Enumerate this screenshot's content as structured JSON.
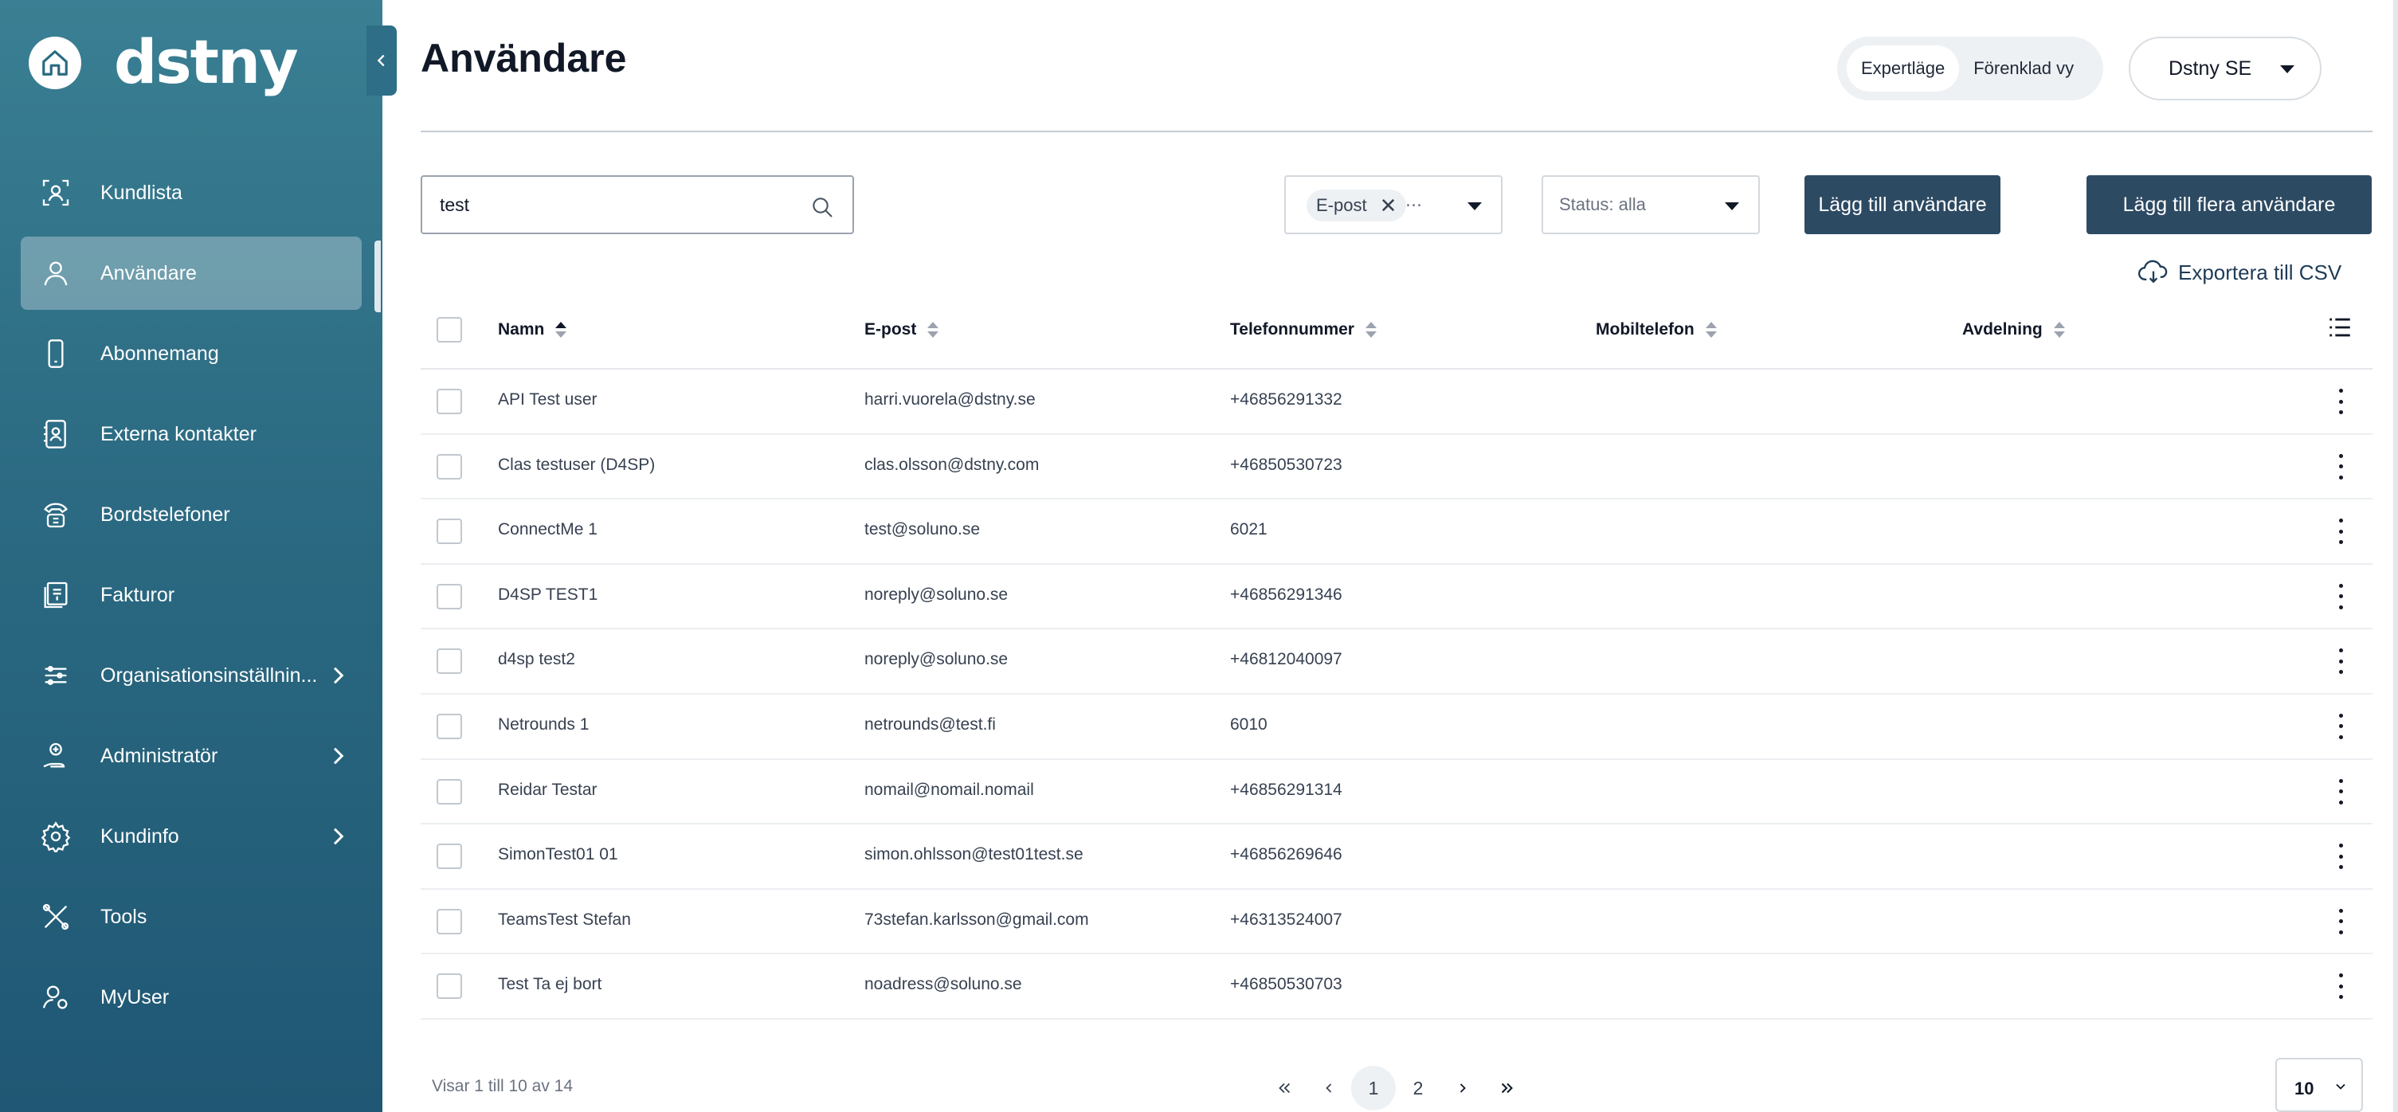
{
  "brand": {
    "logo_text": "dstny"
  },
  "sidebar": {
    "items": [
      {
        "label": "Kundlista",
        "icon": "customer-list-icon"
      },
      {
        "label": "Användare",
        "icon": "user-icon",
        "active": true
      },
      {
        "label": "Abonnemang",
        "icon": "mobile-phone-icon"
      },
      {
        "label": "Externa kontakter",
        "icon": "contact-book-icon"
      },
      {
        "label": "Bordstelefoner",
        "icon": "desk-phone-icon"
      },
      {
        "label": "Fakturor",
        "icon": "invoice-icon"
      },
      {
        "label": "Organisationsinställnin...",
        "icon": "sliders-icon",
        "expandable": true
      },
      {
        "label": "Administratör",
        "icon": "admin-icon",
        "expandable": true
      },
      {
        "label": "Kundinfo",
        "icon": "gear-icon",
        "expandable": true
      },
      {
        "label": "Tools",
        "icon": "tools-icon"
      },
      {
        "label": "MyUser",
        "icon": "user-gear-icon"
      }
    ]
  },
  "header": {
    "title": "Användare",
    "modes": [
      "Expertläge",
      "Förenklad vy"
    ],
    "active_mode": "Expertläge",
    "org_selector": "Dstny SE"
  },
  "toolbar": {
    "search_value": "test",
    "filter_chip": "E-post",
    "filter_more": "...",
    "status_placeholder": "Status: alla",
    "add_user": "Lägg till användare",
    "add_multiple_users": "Lägg till flera användare",
    "export_csv": "Exportera till CSV"
  },
  "table": {
    "columns": [
      "Namn",
      "E-post",
      "Telefonnummer",
      "Mobiltelefon",
      "Avdelning"
    ],
    "sorted_column": "Namn",
    "rows": [
      {
        "name": "API Test user",
        "email": "harri.vuorela@dstny.se",
        "phone": "+46856291332",
        "mobile": "",
        "department": ""
      },
      {
        "name": "Clas testuser (D4SP)",
        "email": "clas.olsson@dstny.com",
        "phone": "+46850530723",
        "mobile": "",
        "department": ""
      },
      {
        "name": "ConnectMe 1",
        "email": "test@soluno.se",
        "phone": "6021",
        "mobile": "",
        "department": ""
      },
      {
        "name": "D4SP TEST1",
        "email": "noreply@soluno.se",
        "phone": "+46856291346",
        "mobile": "",
        "department": ""
      },
      {
        "name": "d4sp test2",
        "email": "noreply@soluno.se",
        "phone": "+46812040097",
        "mobile": "",
        "department": ""
      },
      {
        "name": "Netrounds 1",
        "email": "netrounds@test.fi",
        "phone": "6010",
        "mobile": "",
        "department": ""
      },
      {
        "name": "Reidar Testar",
        "email": "nomail@nomail.nomail",
        "phone": "+46856291314",
        "mobile": "",
        "department": ""
      },
      {
        "name": "SimonTest01 01",
        "email": "simon.ohlsson@test01test.se",
        "phone": "+46856269646",
        "mobile": "",
        "department": ""
      },
      {
        "name": "TeamsTest Stefan",
        "email": "73stefan.karlsson@gmail.com",
        "phone": "+46313524007",
        "mobile": "",
        "department": ""
      },
      {
        "name": "Test Ta ej bort",
        "email": "noadress@soluno.se",
        "phone": "+46850530703",
        "mobile": "",
        "department": ""
      }
    ]
  },
  "footer": {
    "showing": "Visar 1 till 10 av 14",
    "pages": [
      "1",
      "2"
    ],
    "current_page": "1",
    "page_size": "10"
  }
}
